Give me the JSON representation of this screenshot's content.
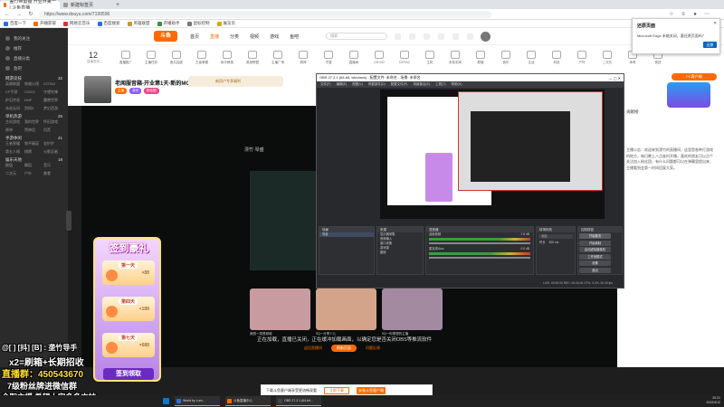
{
  "browser": {
    "tabs": [
      {
        "label": "盖竹带鼠猫 开业界第一 | 斗鱼直播",
        "active": true
      },
      {
        "label": "新建标签页",
        "active": false
      }
    ],
    "url": "https://www.douyu.com/7199596",
    "bookmarks": [
      "百度一下",
      "开播获取",
      "网易云音乐",
      "百度搜索",
      "英雄联盟",
      "开播助手",
      "鼠标控制",
      "展览页"
    ],
    "colors": {
      "douyu_orange": "#ff6a00",
      "obs_bg": "#27292d"
    }
  },
  "edge_popup": {
    "title": "还原页面",
    "message": "Microsoft Edge 未能关闭，要还原页面吗？",
    "button": "还原"
  },
  "page_header": {
    "logo": "斗鱼",
    "nav": [
      "首页",
      "直播",
      "分类",
      "视频",
      "游戏",
      "鱼吧"
    ],
    "active_nav": "直播",
    "search_placeholder": "搜索"
  },
  "category_bar": {
    "day": "12",
    "day_label": "直播签到",
    "items": [
      "直播推广",
      "主播任务",
      "鱼丸抽奖",
      "王者荣耀",
      "和平精英",
      "英雄联盟",
      "主播广场",
      "原神",
      "守望",
      "直播间",
      "CS:GO",
      "DOTA2",
      "主机",
      "永劫无间",
      "颜值",
      "音乐",
      "生活",
      "科技",
      "户外",
      "二次元",
      "体育",
      "竞技"
    ]
  },
  "stream": {
    "title": "老闻服音箱-开业第1天-新的MC征集",
    "tags": [
      "主播",
      "游戏",
      "粉丝团"
    ],
    "promo": "新用户专享福利"
  },
  "sidebar": {
    "top_items": [
      "我的关注",
      "推荐",
      "直播分类",
      "鱼吧"
    ],
    "sections": [
      {
        "title": "网游竞技",
        "count": "32",
        "items": [
          "英雄联盟",
          "穿越火线",
          "DOTA2",
          "CF手游",
          "CSGO",
          "守望先锋",
          "炉石传说",
          "DNF",
          "魔兽世界",
          "永劫无间",
          "剑网3",
          "梦幻西游"
        ]
      },
      {
        "title": "单机热游",
        "count": "26",
        "items": [
          "主机游戏",
          "我的世界",
          "怀旧游戏",
          "原神",
          "黑神话",
          "饥荒"
        ]
      },
      {
        "title": "手游休闲",
        "count": "41",
        "items": [
          "王者荣耀",
          "和平精英",
          "金铲铲",
          "第五人格",
          "棋牌",
          "火影忍者"
        ]
      },
      {
        "title": "娱乐天地",
        "count": "18",
        "items": [
          "颜值",
          "舞蹈",
          "音乐",
          "二次元",
          "户外",
          "美食"
        ]
      }
    ]
  },
  "video": {
    "title": "漂竹·琴盛",
    "tiles": [
      {
        "caption": "美丽一笑很倾城",
        "color": "#c79ba0"
      },
      {
        "caption": "9Q一分享少儿",
        "color": "#d4a48a"
      },
      {
        "caption": "9Q一你想想的主播",
        "color": "#a38aa0"
      }
    ],
    "loading_text": "正在加载，直播已关闭，正在缓冲加载画面，以确定您是否关闭OBS等推流软件",
    "buttons": [
      "返回直播间",
      "刷新页面",
      "问题反馈"
    ]
  },
  "overlay": {
    "title": "签到豪礼",
    "days": [
      {
        "label": "第一天",
        "reward": "×88"
      },
      {
        "label": "第四天",
        "reward": "×188"
      },
      {
        "label": "第七天",
        "reward": "×688"
      }
    ],
    "button": "签到领取"
  },
  "watermark": {
    "line1": "@[ ] [抖] [B] : 垄竹导手",
    "line2": "x2=刷箱+长期招收",
    "line3": "直播群：450543670",
    "line4": "7级粉丝牌进微信群",
    "line5": "全职主播 希望大家多多支持"
  },
  "right_panel": {
    "badge": "PC客户端",
    "rank_label": "贡献榜",
    "announcement": "主播公告：欢迎来到漂竹的直播间，这里是各种打游戏的地方，每日晚上八点准时开播，喜欢的朋友可以点个关注加入粉丝团，有什么问题都可以在弹幕里提出来，主播看到会第一时间回复大家。"
  },
  "obs": {
    "title": "OBS 27.2.1 (64-bit, windows) - 配置文件: 未命名 - 场景: 未命名",
    "menu": [
      "文件(F)",
      "编辑(E)",
      "视图(V)",
      "停靠部件(D)",
      "配置文件(P)",
      "场景集合(S)",
      "工具(T)",
      "帮助(H)"
    ],
    "docks": {
      "scenes_title": "场景",
      "scenes": [
        "场景"
      ],
      "sources_title": "来源",
      "sources": [
        "显示器采集",
        "音频输入",
        "窗口采集",
        "游戏源",
        "图像"
      ],
      "mixer_title": "混音器",
      "mixer": [
        {
          "name": "桌面音频",
          "level": "-7.6 dB"
        },
        {
          "name": "麦克风/Aux",
          "level": "0.0 dB"
        }
      ],
      "transition_title": "转场特效",
      "transition": "淡出",
      "duration_label": "时长",
      "duration": "300 ms",
      "controls_title": "控制按钮",
      "controls": [
        "开始推流",
        "开始录制",
        "启动虚拟摄像机",
        "工作室模式",
        "设置",
        "退出"
      ]
    },
    "status": "LIVE: 00:00:00  REC: 00:00:00  CPU: 3.4%, 30.00 fps"
  },
  "bottom_bar": {
    "text": "下载斗鱼客户端享受更流畅观看",
    "btn1": "立即下载",
    "btn2": "安装斗鱼客户端"
  },
  "taskbar": {
    "apps": [
      "World by Lum...",
      "斗鱼直播中心",
      "OBS 27.2.1 (64-bit..."
    ],
    "time": "20:21",
    "date": "2022/4/12"
  }
}
